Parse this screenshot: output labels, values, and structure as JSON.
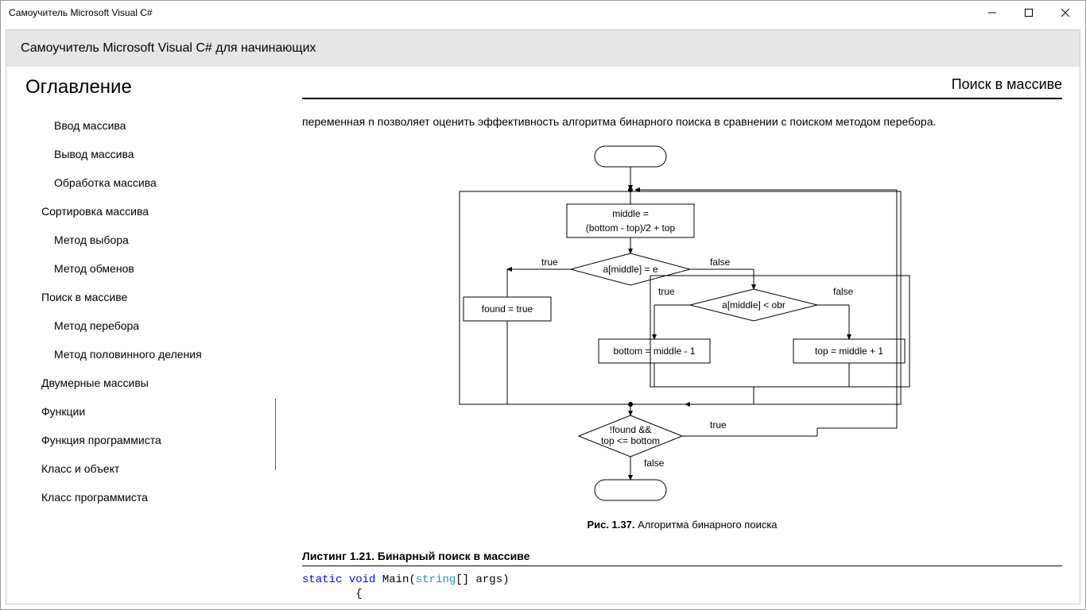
{
  "window": {
    "title": "Самоучитель Microsoft Visual C#"
  },
  "header": {
    "subtitle": "Самоучитель Microsoft Visual C# для начинающих"
  },
  "sidebar": {
    "title": "Оглавление",
    "items": [
      {
        "label": "Ввод массива",
        "level": 1
      },
      {
        "label": "Вывод массива",
        "level": 1
      },
      {
        "label": "Обработка массива",
        "level": 1
      },
      {
        "label": "Сортировка массива",
        "level": 0
      },
      {
        "label": "Метод выбора",
        "level": 1
      },
      {
        "label": "Метод обменов",
        "level": 1
      },
      {
        "label": "Поиск в массиве",
        "level": 0
      },
      {
        "label": "Метод перебора",
        "level": 1
      },
      {
        "label": "Метод половинного деления",
        "level": 1
      },
      {
        "label": "Двумерные массивы",
        "level": 0
      },
      {
        "label": "Функции",
        "level": 0
      },
      {
        "label": "Функция программиста",
        "level": 0
      },
      {
        "label": "Класс и объект",
        "level": 0
      },
      {
        "label": "Класс программиста",
        "level": 0
      }
    ]
  },
  "content": {
    "page_title": "Поиск в массиве",
    "paragraph": "переменная n позволяет оценить эффективность алгоритма бинарного поиска в сравнении с поиском методом перебора.",
    "caption_prefix": "Рис. 1.37.",
    "caption_text": " Алгоритма бинарного поиска",
    "listing_title": "Листинг 1.21. Бинарный поиск в массиве",
    "code": {
      "kw1": "static",
      "kw2": "void",
      "name": " Main(",
      "type": "string",
      "rest": "[] args)",
      "brace": "        {"
    }
  },
  "diagram": {
    "box_middle_l1": "middle =",
    "box_middle_l2": "(bottom - top)/2  + top",
    "cond1": "a[middle] = e",
    "cond2": "a[middle] < obr",
    "cond3_l1": "!found &&",
    "cond3_l2": "top <= bottom",
    "box_found": "found = true",
    "box_bottom": "bottom = middle - 1",
    "box_top": "top = middle + 1",
    "true": "true",
    "false": "false"
  }
}
